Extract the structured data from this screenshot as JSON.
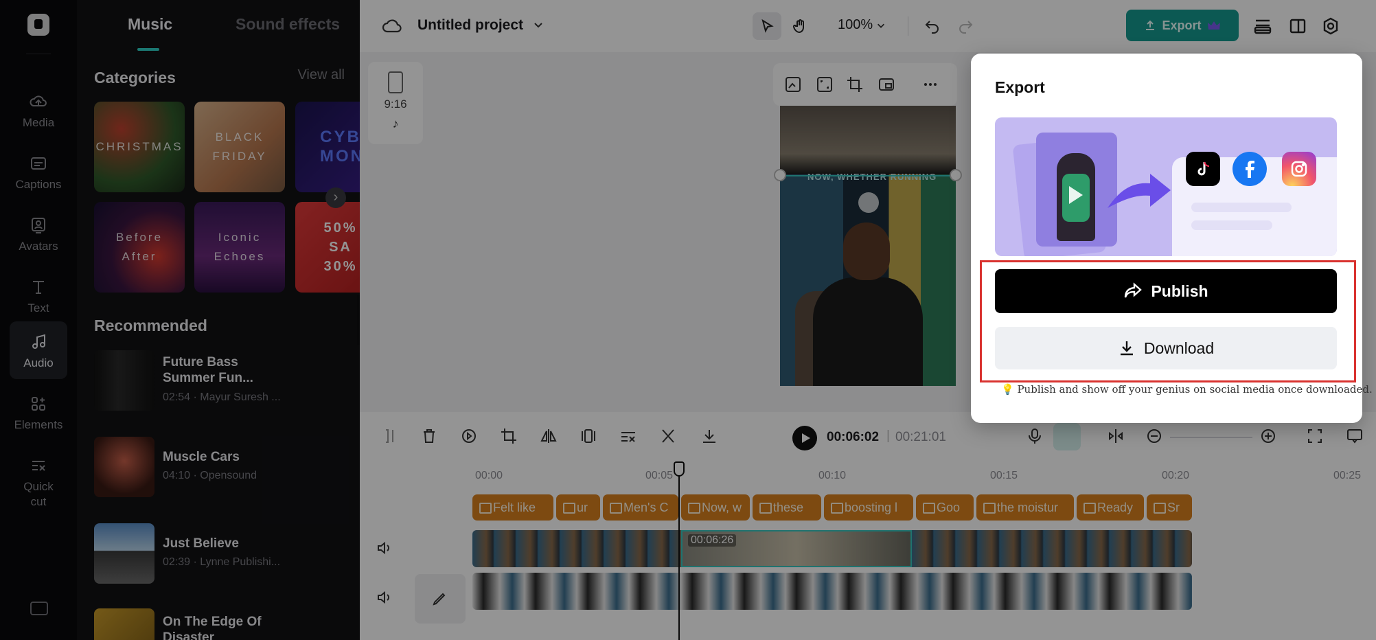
{
  "rail": {
    "items": [
      {
        "label": "Media",
        "icon": "cloud-upload-icon"
      },
      {
        "label": "Captions",
        "icon": "captions-icon"
      },
      {
        "label": "Avatars",
        "icon": "avatar-icon"
      },
      {
        "label": "Text",
        "icon": "text-icon"
      },
      {
        "label": "Audio",
        "icon": "music-note-icon",
        "active": true
      },
      {
        "label": "Elements",
        "icon": "elements-icon"
      },
      {
        "label": "Quick cut",
        "icon": "quick-cut-icon"
      }
    ]
  },
  "panel": {
    "tabs": [
      "Music",
      "Sound effects"
    ],
    "active_tab": "Music",
    "categories_title": "Categories",
    "view_all": "View all",
    "categories": [
      {
        "label": "CHRISTMAS"
      },
      {
        "label": "BLACK FRIDAY"
      },
      {
        "label": "CYB MON"
      },
      {
        "label": "Before After"
      },
      {
        "label": "Iconic Echoes"
      },
      {
        "label": "50% SA 30%"
      }
    ],
    "recommended_title": "Recommended",
    "tracks": [
      {
        "title": "Future Bass Summer Fun...",
        "meta": "02:54 · Mayur Suresh ..."
      },
      {
        "title": "Muscle Cars",
        "meta": "04:10 · Opensound"
      },
      {
        "title": "Just Believe",
        "meta": "02:39 · Lynne Publishi..."
      },
      {
        "title": "On The Edge Of Disaster",
        "meta": ""
      }
    ]
  },
  "topbar": {
    "project_title": "Untitled project",
    "zoom": "100%",
    "export_label": "Export"
  },
  "canvas": {
    "ratio_label": "9:16",
    "caption_overlay": "NOW, WHETHER RUNNING"
  },
  "timeline": {
    "current_time": "00:06:02",
    "separator": "|",
    "total_time": "00:21:01",
    "ruler_ticks": [
      "00:00",
      "00:05",
      "00:10",
      "00:15",
      "00:20",
      "00:25"
    ],
    "caption_chips": [
      "Felt like",
      "ur",
      "Men's C",
      "Now, w",
      "these",
      "boosting l",
      "Goo",
      "the moistur",
      "Ready",
      "Sr"
    ],
    "clip_time": "00:06:26"
  },
  "export_modal": {
    "title": "Export",
    "publish_label": "Publish",
    "download_label": "Download",
    "tip": "Publish and show off your genius on social media once downloaded."
  },
  "colors": {
    "accent": "#2fd1c6",
    "export_button": "#159a8f",
    "caption_chip": "#d7801e",
    "highlight_outline": "#d9322f"
  }
}
